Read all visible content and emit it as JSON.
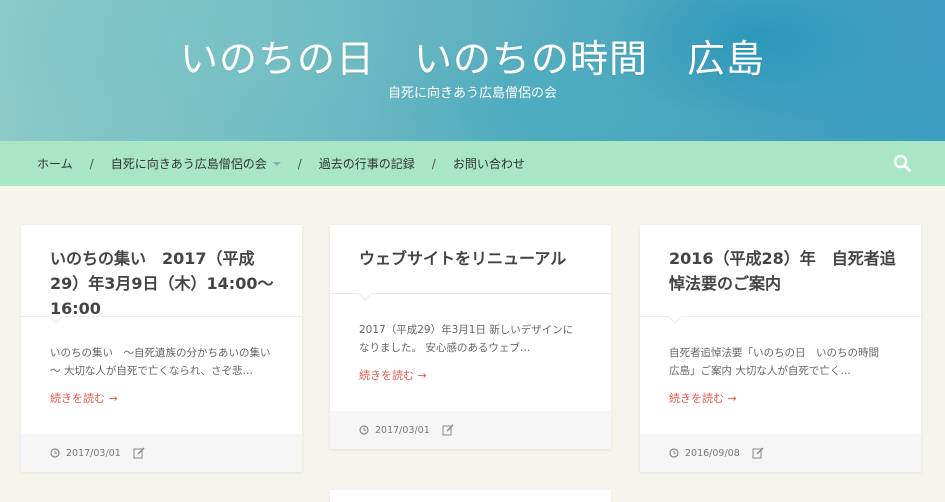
{
  "header": {
    "title": "いのちの日　いのちの時間　広島",
    "tagline": "自死に向きあう広島僧侶の会"
  },
  "nav": {
    "items": [
      "ホーム",
      "自死に向きあう広島僧侶の会",
      "過去の行事の記録",
      "お問い合わせ"
    ],
    "separator": "/",
    "search_icon": "search-icon"
  },
  "posts": [
    {
      "title": "いのちの集い　2017（平成29）年3月9日（木）14:00〜16:00",
      "excerpt": "いのちの集い　～自死遺族の分かちあいの集い～ 大切な人が自死で亡くなられ、さぞ悲…",
      "more": "続きを読む →",
      "date": "2017/03/01"
    },
    {
      "title": "ウェブサイトをリニューアル",
      "excerpt": "2017（平成29）年3月1日 新しいデザインになりました。 安心感のあるウェブ…",
      "more": "続きを読む →",
      "date": "2017/03/01"
    },
    {
      "title": "2016（平成28）年　自死者追悼法要のご案内",
      "excerpt": "自死者追悼法要「いのちの日　いのちの時間　広島」ご案内 大切な人が自死で亡く…",
      "more": "続きを読む →",
      "date": "2016/09/08"
    }
  ],
  "colors": {
    "nav_bg": "#a8e6c6",
    "page_bg": "#f5f5ec",
    "link": "#e8584b"
  }
}
